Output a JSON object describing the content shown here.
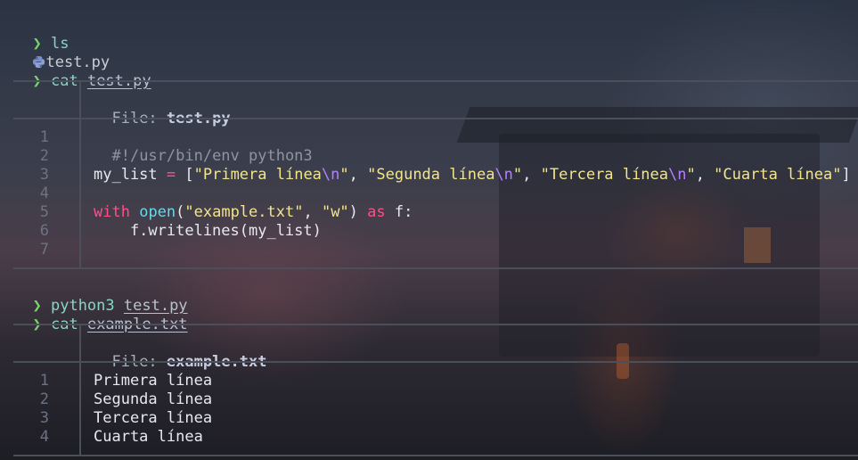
{
  "terminal": {
    "prompt_symbol": "❯",
    "commands": [
      {
        "cmd": "ls",
        "arg": ""
      },
      {
        "cmd": "cat",
        "arg": "test.py"
      },
      {
        "cmd": "python3",
        "arg": "test.py"
      },
      {
        "cmd": "cat",
        "arg": "example.txt"
      }
    ],
    "ls_output": {
      "icon": "python-icon",
      "name": "test.py"
    }
  },
  "viewer1": {
    "header_label": "File: ",
    "header_file": "test.py",
    "line_numbers": [
      "1",
      "2",
      "3",
      "4",
      "5",
      "6",
      "7"
    ],
    "code": {
      "shebang": "#!/usr/bin/env python3",
      "l3_var": "my_list ",
      "l3_eq": "=",
      "l3_open": " [",
      "s1": "\"Primera línea",
      "s1_esc": "\\n",
      "s1_end": "\"",
      "comma1": ", ",
      "s2": "\"Segunda línea",
      "s2_esc": "\\n",
      "s2_end": "\"",
      "comma2": ", ",
      "s3": "\"Tercera línea",
      "s3_esc": "\\n",
      "s3_end": "\"",
      "comma3": ", ",
      "s4": "\"Cuarta línea\"",
      "l3_close": "]",
      "l5_with": "with",
      "l5_sp": " ",
      "l5_open": "open",
      "l5_paren": "(",
      "l5_s1": "\"example.txt\"",
      "l5_comma": ", ",
      "l5_s2": "\"w\"",
      "l5_close": ") ",
      "l5_as": "as",
      "l5_f": " f:",
      "l6": "    f.writelines(my_list)"
    }
  },
  "viewer2": {
    "header_label": "File: ",
    "header_file": "example.txt",
    "line_numbers": [
      "1",
      "2",
      "3",
      "4"
    ],
    "lines": [
      "Primera línea",
      "Segunda línea",
      "Tercera línea",
      "Cuarta línea"
    ]
  },
  "colors": {
    "prompt": "#7ad36b",
    "keyword": "#ff4f8a",
    "string": "#f2e58a",
    "escape": "#b480ff",
    "builtin": "#6ad7e8"
  }
}
